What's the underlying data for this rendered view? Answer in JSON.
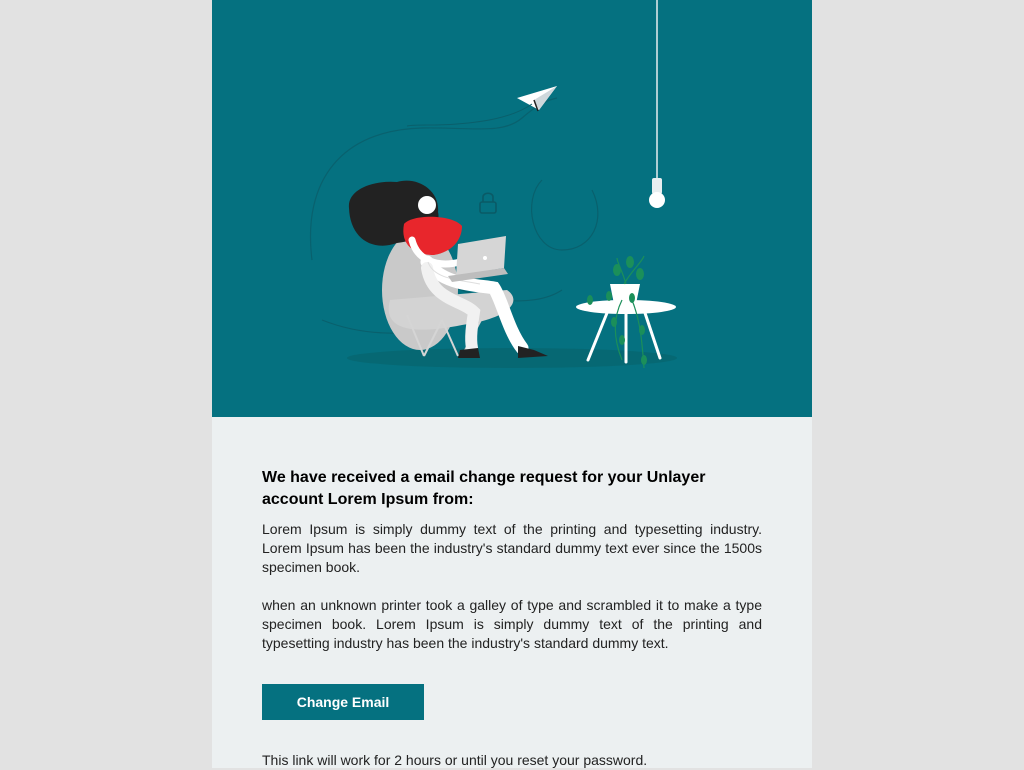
{
  "email": {
    "heading": "We have received a email change request for your Unlayer account Lorem Ipsum from:",
    "paragraphs": [
      "Lorem Ipsum is simply dummy text of the printing and typesetting industry. Lorem Ipsum has been the industry's standard dummy text ever since the 1500s specimen book.",
      "when an unknown printer took a galley of type and scrambled it to make a type specimen book. Lorem Ipsum is simply dummy text of the printing and typesetting industry has been the industry's standard dummy text."
    ],
    "button_label": "Change Email",
    "note": "This link will work for 2 hours or until you reset your password."
  },
  "hero": {
    "illustration": "person-with-laptop-illustration",
    "icons": [
      "paper-plane-icon",
      "lock-icon",
      "lightbulb-icon",
      "plant-icon"
    ]
  },
  "colors": {
    "page_background": "#e2e2e2",
    "email_background": "#ecf0f1",
    "hero_background": "#057180",
    "accent": "#057180",
    "button_text": "#ffffff",
    "shirt": "#e8262c",
    "hair": "#222222"
  }
}
